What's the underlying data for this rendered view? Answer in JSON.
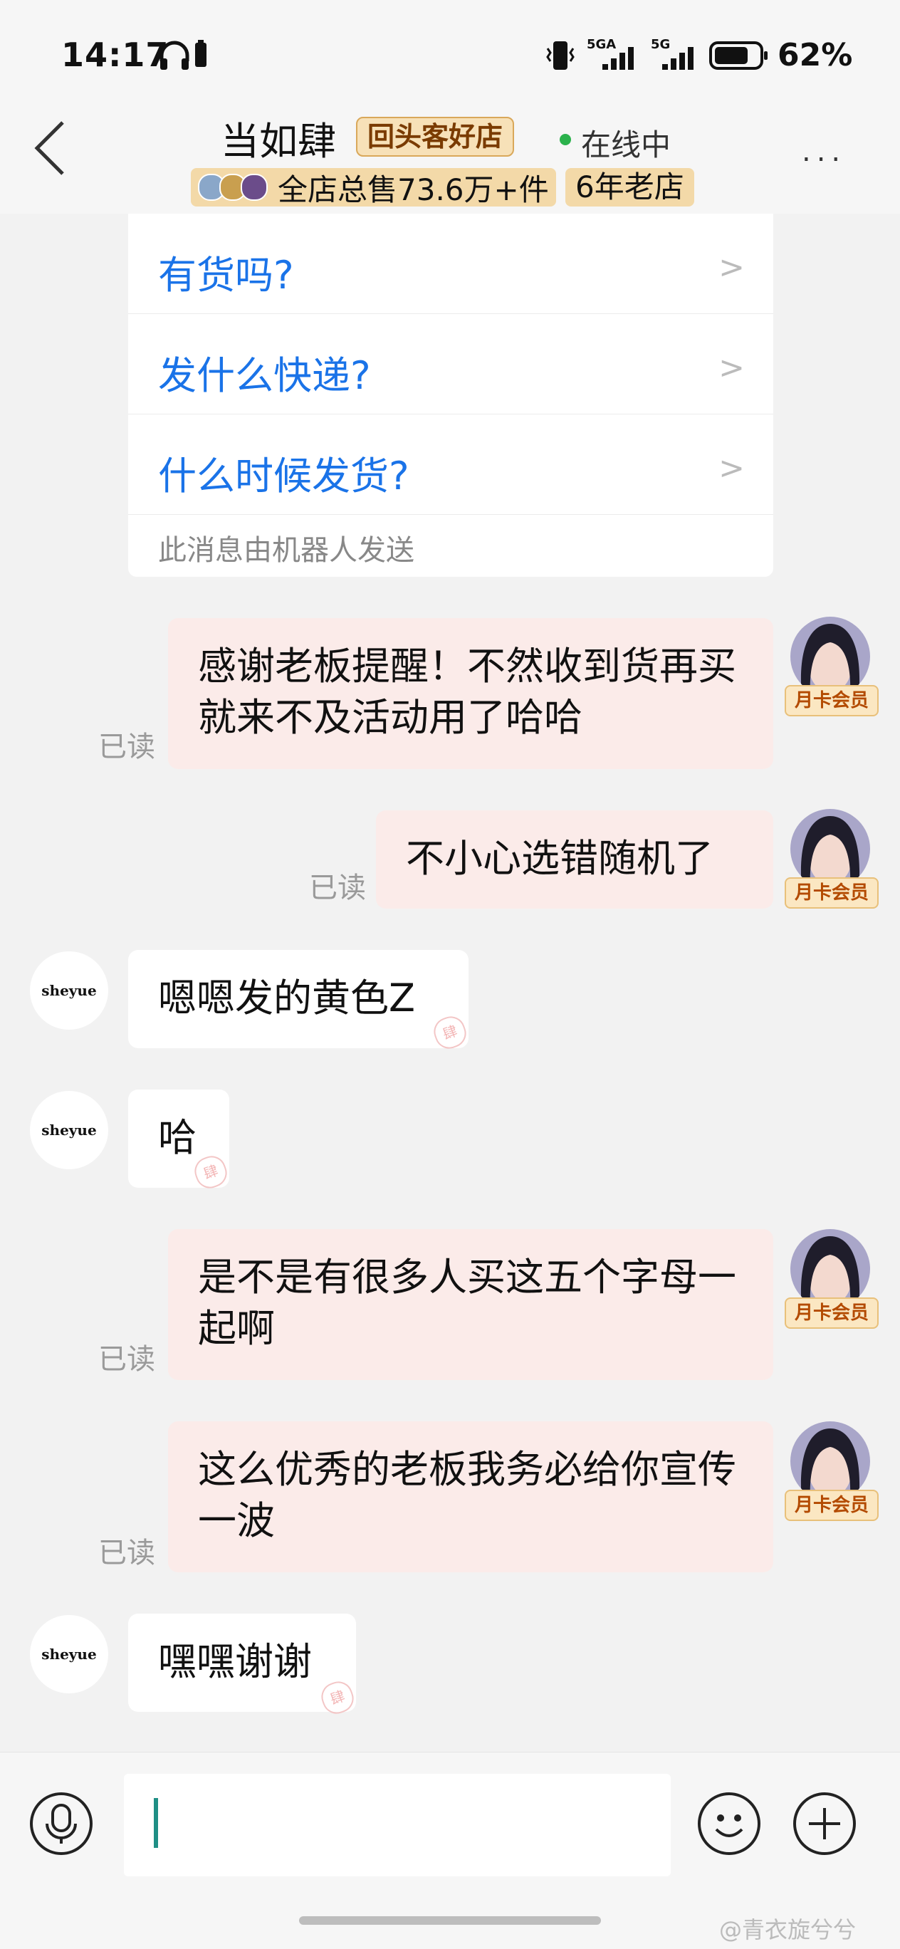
{
  "status_bar": {
    "time": "14:17",
    "battery_percent": "62%",
    "signal_labels": [
      "5GA",
      "5G"
    ],
    "icons": [
      "headphones-icon",
      "battery-small-icon",
      "vibrate-icon",
      "signal-5ga-icon",
      "signal-5g-icon",
      "battery-icon"
    ]
  },
  "header": {
    "shop_name": "当如肆",
    "shop_badge": "回头客好店",
    "online_status": "在线中",
    "sales_stat": "全店总售73.6万+件",
    "shop_age": "6年老店",
    "more_label": "..."
  },
  "robot_card": {
    "questions": [
      "有货吗?",
      "发什么快递?",
      "什么时候发货?"
    ],
    "footer": "此消息由机器人发送"
  },
  "messages": {
    "m1": {
      "from": "me",
      "text": "感谢老板提醒！不然收到货再买就来不及活动用了哈哈",
      "read": "已读"
    },
    "m2": {
      "from": "me",
      "text": "不小心选错随机了",
      "read": "已读"
    },
    "m3": {
      "from": "shop",
      "text": "嗯嗯发的黄色Z",
      "avatar": "sheyue"
    },
    "m4": {
      "from": "shop",
      "text": "哈",
      "avatar": "sheyue"
    },
    "m5": {
      "from": "me",
      "text": "是不是有很多人买这五个字母一起啊",
      "read": "已读"
    },
    "m6": {
      "from": "me",
      "text": "这么优秀的老板我务必给你宣传一波",
      "read": "已读"
    },
    "m7": {
      "from": "shop",
      "text": "嘿嘿谢谢",
      "avatar": "sheyue"
    }
  },
  "user": {
    "vip_label": "月卡会员"
  },
  "input_bar": {
    "value": "",
    "icons": [
      "microphone-icon",
      "emoji-icon",
      "plus-icon"
    ]
  },
  "watermark": "@青衣旋兮兮",
  "colors": {
    "link": "#1a73e8",
    "my_bubble": "#fbebe9",
    "online": "#2bb24c",
    "badge_bg": "#f3d9a8"
  }
}
